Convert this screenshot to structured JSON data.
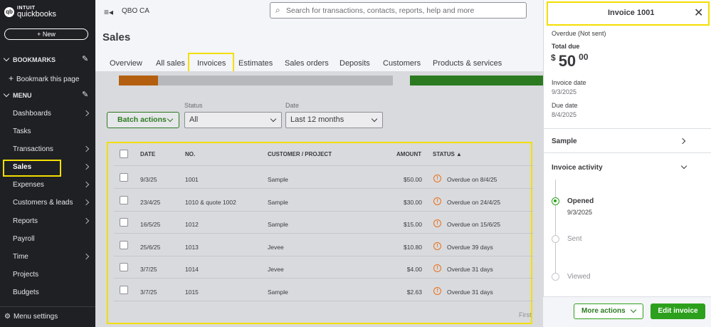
{
  "brand": {
    "top": "INTUIT",
    "bottom": "quickbooks",
    "mark": "qb"
  },
  "sidebar": {
    "new_label": "+ New",
    "bookmarks": "BOOKMARKS",
    "bookmark_page": "Bookmark this page",
    "menu": "MENU",
    "items": [
      {
        "label": "Dashboards",
        "chev": true
      },
      {
        "label": "Tasks",
        "chev": false
      },
      {
        "label": "Transactions",
        "chev": true
      },
      {
        "label": "Sales",
        "chev": true
      },
      {
        "label": "Expenses",
        "chev": true
      },
      {
        "label": "Customers & leads",
        "chev": true
      },
      {
        "label": "Reports",
        "chev": true
      },
      {
        "label": "Payroll",
        "chev": false
      },
      {
        "label": "Time",
        "chev": true
      },
      {
        "label": "Projects",
        "chev": false
      },
      {
        "label": "Budgets",
        "chev": false
      }
    ],
    "menu_settings": "Menu settings"
  },
  "header": {
    "company": "QBO CA",
    "search_placeholder": "Search for transactions, contacts, reports, help and more"
  },
  "page": {
    "title": "Sales"
  },
  "tabs": [
    "Overview",
    "All sales",
    "Invoices",
    "Estimates",
    "Sales orders",
    "Deposits",
    "Customers",
    "Products & services"
  ],
  "filters": {
    "batch": "Batch actions",
    "status_label": "Status",
    "status_value": "All",
    "date_label": "Date",
    "date_value": "Last 12 months"
  },
  "table": {
    "headers": [
      "DATE",
      "NO.",
      "CUSTOMER / PROJECT",
      "AMOUNT",
      "STATUS ▲"
    ],
    "rows": [
      {
        "date": "9/3/25",
        "no": "1001",
        "customer": "Sample",
        "amount": "$50.00",
        "status": "Overdue on 8/4/25"
      },
      {
        "date": "23/4/25",
        "no": "1010 & quote 1002",
        "customer": "Sample",
        "amount": "$30.00",
        "status": "Overdue on 24/4/25"
      },
      {
        "date": "16/5/25",
        "no": "1012",
        "customer": "Sample",
        "amount": "$15.00",
        "status": "Overdue on 15/6/25"
      },
      {
        "date": "25/6/25",
        "no": "1013",
        "customer": "Jevee",
        "amount": "$10.80",
        "status": "Overdue 39 days"
      },
      {
        "date": "3/7/25",
        "no": "1014",
        "customer": "Jevee",
        "amount": "$4.00",
        "status": "Overdue 31 days"
      },
      {
        "date": "3/7/25",
        "no": "1015",
        "customer": "Sample",
        "amount": "$2.63",
        "status": "Overdue 31 days"
      }
    ],
    "pager": "First"
  },
  "panel": {
    "title": "Invoice 1001",
    "status": "Overdue (Not sent)",
    "total_label": "Total due",
    "currency": "$",
    "amount_main": "50",
    "amount_cents": "00",
    "invoice_date_label": "Invoice date",
    "invoice_date": "9/3/2025",
    "due_date_label": "Due date",
    "due_date": "8/4/2025",
    "customer": "Sample",
    "activity_label": "Invoice activity",
    "activity": [
      {
        "label": "Opened",
        "date": "9/3/2025"
      },
      {
        "label": "Sent",
        "date": ""
      },
      {
        "label": "Viewed",
        "date": ""
      }
    ],
    "more_actions": "More actions",
    "edit_invoice": "Edit invoice"
  },
  "colors": {
    "sidebar": "#1f2024",
    "highlight": "#f2df00",
    "green": "#2ca01c",
    "overdue": "#e8711a"
  }
}
